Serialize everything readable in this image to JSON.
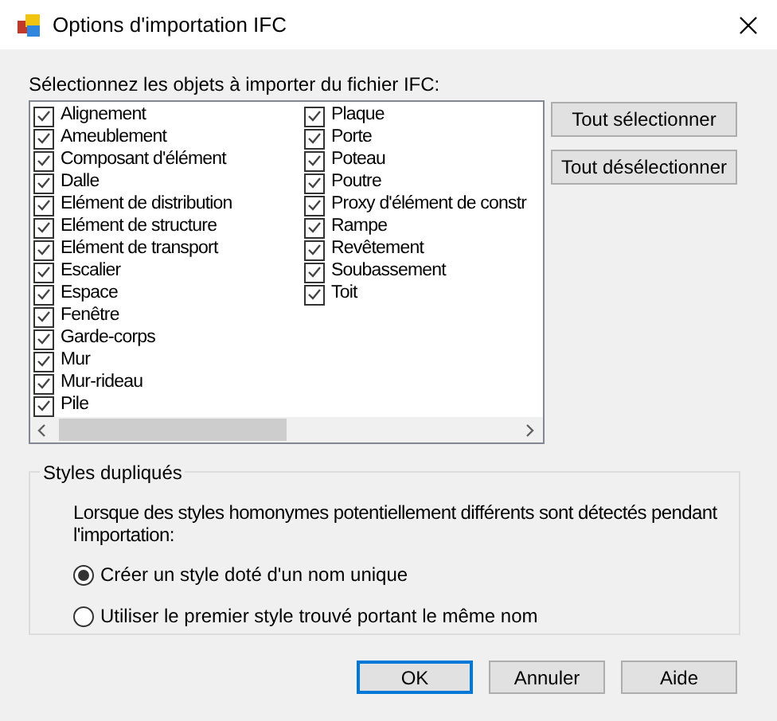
{
  "window": {
    "title": "Options d'importation IFC"
  },
  "prompt": "Sélectionnez les objets à importer du fichier IFC:",
  "object_columns": [
    [
      {
        "label": "Alignement",
        "checked": true
      },
      {
        "label": "Ameublement",
        "checked": true
      },
      {
        "label": "Composant d'élément",
        "checked": true
      },
      {
        "label": "Dalle",
        "checked": true
      },
      {
        "label": "Elément de distribution",
        "checked": true
      },
      {
        "label": "Elément de structure",
        "checked": true
      },
      {
        "label": "Elément de transport",
        "checked": true
      },
      {
        "label": "Escalier",
        "checked": true
      },
      {
        "label": "Espace",
        "checked": true
      },
      {
        "label": "Fenêtre",
        "checked": true
      },
      {
        "label": "Garde-corps",
        "checked": true
      },
      {
        "label": "Mur",
        "checked": true
      },
      {
        "label": "Mur-rideau",
        "checked": true
      },
      {
        "label": "Pile",
        "checked": true
      }
    ],
    [
      {
        "label": "Plaque",
        "checked": true
      },
      {
        "label": "Porte",
        "checked": true
      },
      {
        "label": "Poteau",
        "checked": true
      },
      {
        "label": "Poutre",
        "checked": true
      },
      {
        "label": "Proxy d'élément de constr",
        "checked": true
      },
      {
        "label": "Rampe",
        "checked": true
      },
      {
        "label": "Revêtement",
        "checked": true
      },
      {
        "label": "Soubassement",
        "checked": true
      },
      {
        "label": "Toit",
        "checked": true
      }
    ]
  ],
  "side_buttons": [
    "Tout sélectionner",
    "Tout désélectionner"
  ],
  "duplicate_styles": {
    "title": "Styles dupliqués",
    "description": "Lorsque des styles homonymes potentiellement différents sont détectés pendant l'importation:",
    "options": [
      {
        "label": "Créer un style doté d'un nom unique",
        "selected": true
      },
      {
        "label": "Utiliser le premier style trouvé portant le même nom",
        "selected": false
      }
    ]
  },
  "buttons": [
    {
      "label": "OK",
      "default": true
    },
    {
      "label": "Annuler",
      "default": false
    },
    {
      "label": "Aide",
      "default": false
    }
  ]
}
